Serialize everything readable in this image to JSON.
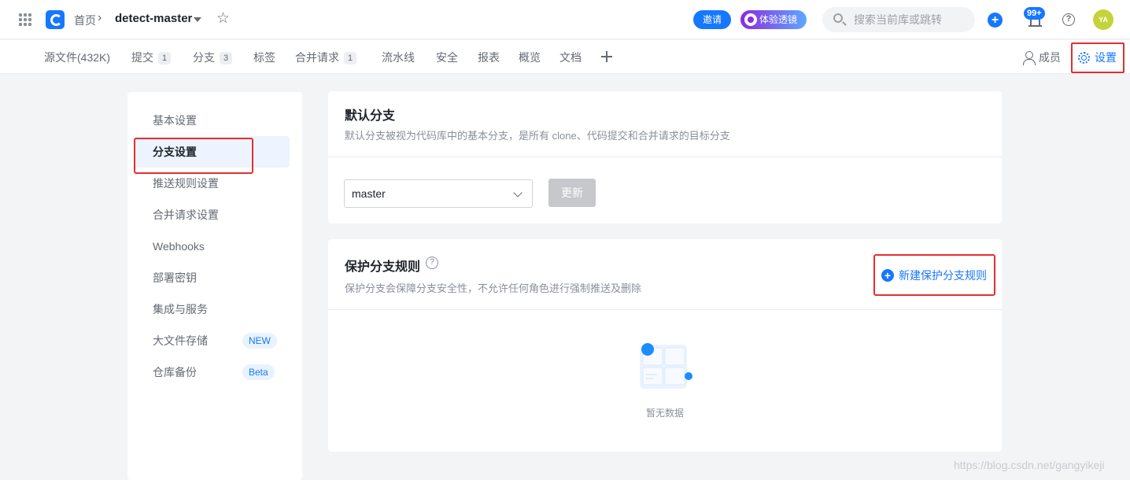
{
  "header": {
    "breadcrumb_home": "首页",
    "breadcrumb_sep": "›",
    "repo_name": "detect-master",
    "invite_label": "邀请",
    "lens_label": "体验透镜",
    "search_placeholder": "搜索当前库或跳转",
    "add_label": "+",
    "notification_count": "99+",
    "help_label": "?",
    "avatar_initials": "YA"
  },
  "tabs": [
    {
      "label": "源文件(432K)"
    },
    {
      "label": "提交",
      "count": "1"
    },
    {
      "label": "分支",
      "count": "3"
    },
    {
      "label": "标签"
    },
    {
      "label": "合并请求",
      "count": "1"
    },
    {
      "label": "流水线"
    },
    {
      "label": "安全"
    },
    {
      "label": "报表"
    },
    {
      "label": "概览"
    },
    {
      "label": "文档"
    }
  ],
  "right_tabs": {
    "members": "成员",
    "settings": "设置"
  },
  "sidebar": {
    "items": [
      {
        "label": "基本设置"
      },
      {
        "label": "分支设置",
        "active": true
      },
      {
        "label": "推送规则设置"
      },
      {
        "label": "合并请求设置"
      },
      {
        "label": "Webhooks"
      },
      {
        "label": "部署密钥"
      },
      {
        "label": "集成与服务"
      },
      {
        "label": "大文件存储",
        "badge": "NEW"
      },
      {
        "label": "仓库备份",
        "badge": "Beta"
      }
    ]
  },
  "default_branch": {
    "title": "默认分支",
    "description": "默认分支被视为代码库中的基本分支，是所有 clone、代码提交和合并请求的目标分支",
    "selected": "master",
    "update_label": "更新"
  },
  "protected_branch": {
    "title": "保护分支规则",
    "help_label": "?",
    "description": "保护分支会保障分支安全性，不允许任何角色进行强制推送及删除",
    "new_rule_label": "新建保护分支规则",
    "empty_text": "暂无数据"
  },
  "watermark": "https://blog.csdn.net/gangyikeji",
  "colors": {
    "accent": "#1677ff",
    "highlight": "#e62e2e",
    "avatar": "#c4d33a"
  }
}
